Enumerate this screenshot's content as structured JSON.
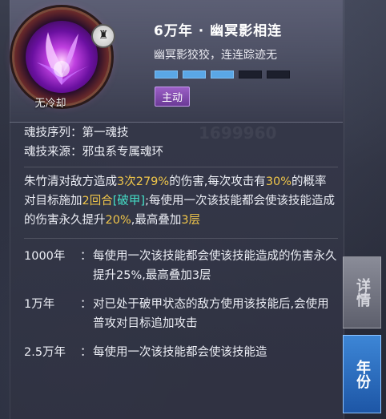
{
  "skill": {
    "title": "6万年 · 幽冥影相连",
    "subtitle": "幽冥影狡狡，连连踪迹无",
    "cooldown": "无冷却",
    "type_tag": "主动",
    "level_filled": 3,
    "level_total": 5,
    "icon": "purple-claw-soul-icon",
    "badge_icon": "lock-icon"
  },
  "info": {
    "seq_label": "魂技序列：",
    "seq_value": "第一魂技",
    "source_label": "魂技来源：",
    "source_value": "邪虫系专属魂环"
  },
  "description": {
    "part1": "朱竹清对敌方造成",
    "hits": "3次",
    "dmg": "279%",
    "part2": "的伤害,每次攻击有",
    "chance": "30%",
    "part3": "的概率对目标施加",
    "rounds": "2回合",
    "status": "[破甲]",
    "part4": ";每使用一次该技能都会使该技能造成的伤害永久提升",
    "boost": "20%",
    "part5": ",最高叠加",
    "stacks": "3层"
  },
  "year_effects": [
    {
      "year": "1000年",
      "colon": "：",
      "text": "每使用一次该技能都会使该技能造成的伤害永久提升25%,最高叠加3层"
    },
    {
      "year": "1万年",
      "colon": "：",
      "text": "对已处于破甲状态的敌方使用该技能后,会使用普攻对目标追加攻击"
    },
    {
      "year": "2.5万年",
      "colon": "：",
      "text": "每使用一次该技能都会使该技能造"
    }
  ],
  "tabs": {
    "detail": "详情",
    "year": "年份"
  },
  "watermark": "1699960",
  "colors": {
    "highlight": "#f0c64a",
    "status": "#44e0c8",
    "active_tab": "#2f74c8",
    "tag": "#8a4fb8",
    "level_bar": "#5aa7e6"
  }
}
